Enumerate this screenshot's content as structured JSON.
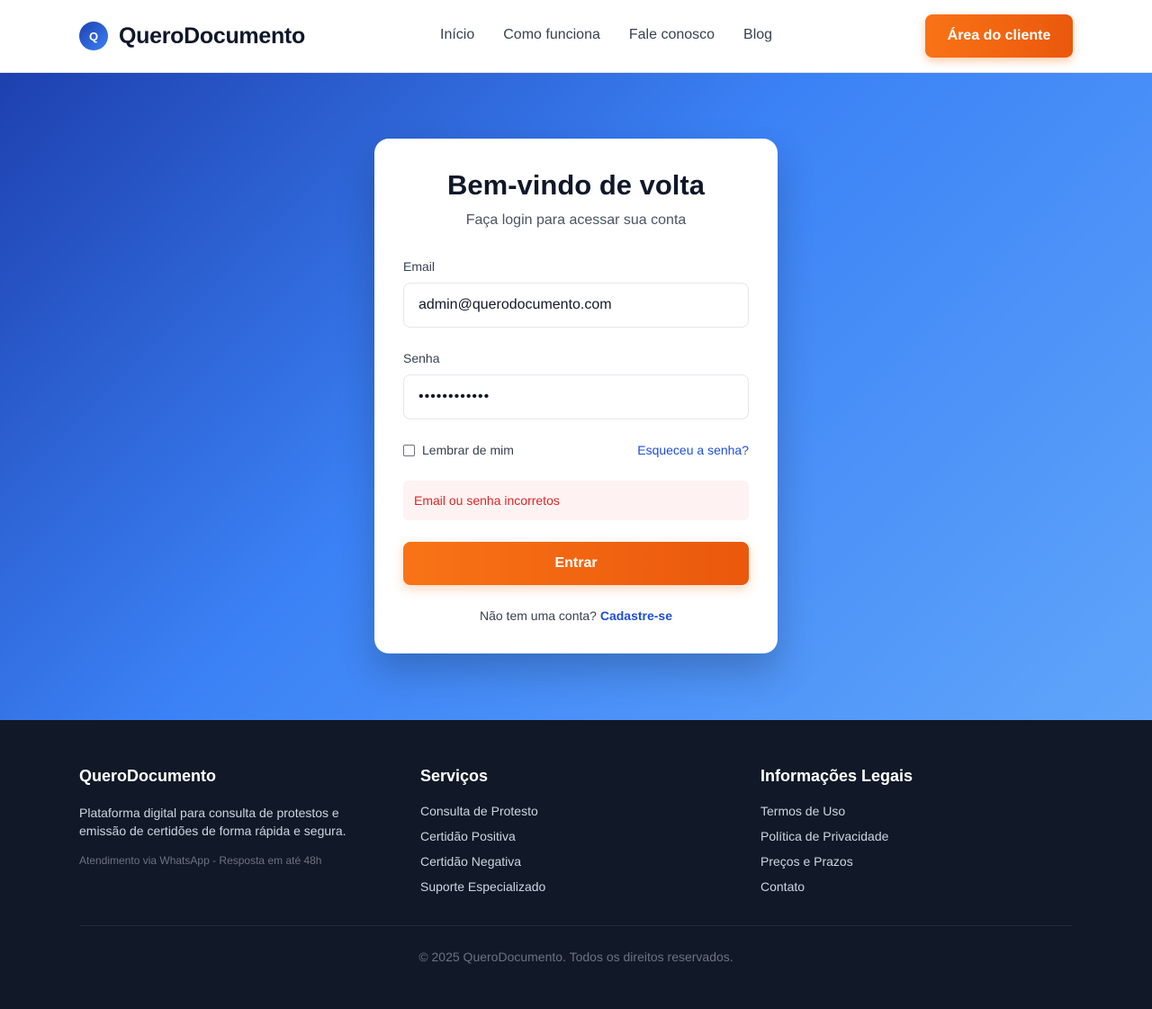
{
  "header": {
    "logo_letter": "Q",
    "brand": "QueroDocumento",
    "nav": [
      "Início",
      "Como funciona",
      "Fale conosco",
      "Blog"
    ],
    "client_button": "Área do cliente"
  },
  "login": {
    "title": "Bem-vindo de volta",
    "subtitle": "Faça login para acessar sua conta",
    "email_label": "Email",
    "email_value": "admin@querodocumento.com",
    "password_label": "Senha",
    "password_value": "••••••••••••",
    "remember_label": "Lembrar de mim",
    "remember_checked": false,
    "forgot_link": "Esqueceu a senha?",
    "error_message": "Email ou senha incorretos",
    "submit_label": "Entrar",
    "signup_prompt": "Não tem uma conta?",
    "signup_link": "Cadastre-se"
  },
  "footer": {
    "about": {
      "title": "QueroDocumento",
      "description": "Plataforma digital para consulta de protestos e emissão de certidões de forma rápida e segura.",
      "note": "Atendimento via WhatsApp - Resposta em até 48h"
    },
    "services": {
      "title": "Serviços",
      "links": [
        "Consulta de Protesto",
        "Certidão Positiva",
        "Certidão Negativa",
        "Suporte Especializado"
      ]
    },
    "legal": {
      "title": "Informações Legais",
      "links": [
        "Termos de Uso",
        "Política de Privacidade",
        "Preços e Prazos",
        "Contato"
      ]
    },
    "copyright": "© 2025 QueroDocumento. Todos os direitos reservados."
  },
  "colors": {
    "accent_orange": "#f97316",
    "brand_blue": "#3b82f6",
    "link_blue": "#1d4ed8",
    "error_red": "#dc2626",
    "footer_bg": "#111827"
  }
}
